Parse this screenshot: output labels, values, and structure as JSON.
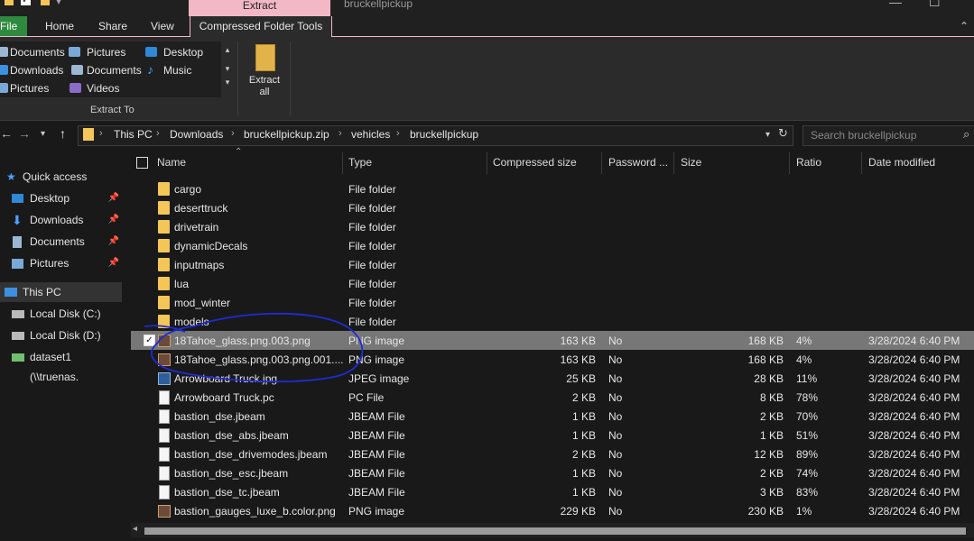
{
  "window": {
    "title": "bruckellpickup",
    "context_tab": "Extract"
  },
  "ribbon_tabs": [
    "File",
    "Home",
    "Share",
    "View",
    "Compressed Folder Tools"
  ],
  "ribbon": {
    "gallery": [
      [
        "Documents",
        "Pictures",
        "Desktop"
      ],
      [
        "Downloads",
        "Documents",
        "Music"
      ],
      [
        "Pictures",
        "Videos",
        ""
      ]
    ],
    "group_label": "Extract To",
    "extract_all_line1": "Extract",
    "extract_all_line2": "all"
  },
  "address": {
    "crumbs": [
      "This PC",
      "Downloads",
      "bruckellpickup.zip",
      "vehicles",
      "bruckellpickup"
    ],
    "search_placeholder": "Search bruckellpickup"
  },
  "nav": {
    "quick_access": "Quick access",
    "items": [
      "Desktop",
      "Downloads",
      "Documents",
      "Pictures"
    ],
    "this_pc": "This PC",
    "drives": [
      "Local Disk (C:)",
      "Local Disk (D:)",
      "dataset1 (\\\\truenas."
    ]
  },
  "columns": [
    "Name",
    "Type",
    "Compressed size",
    "Password ...",
    "Size",
    "Ratio",
    "Date modified"
  ],
  "files": [
    {
      "name": "cargo",
      "type": "File folder",
      "csize": "",
      "pw": "",
      "size": "",
      "ratio": "",
      "date": "",
      "icon": "folder"
    },
    {
      "name": "deserttruck",
      "type": "File folder",
      "csize": "",
      "pw": "",
      "size": "",
      "ratio": "",
      "date": "",
      "icon": "folder"
    },
    {
      "name": "drivetrain",
      "type": "File folder",
      "csize": "",
      "pw": "",
      "size": "",
      "ratio": "",
      "date": "",
      "icon": "folder"
    },
    {
      "name": "dynamicDecals",
      "type": "File folder",
      "csize": "",
      "pw": "",
      "size": "",
      "ratio": "",
      "date": "",
      "icon": "folder"
    },
    {
      "name": "inputmaps",
      "type": "File folder",
      "csize": "",
      "pw": "",
      "size": "",
      "ratio": "",
      "date": "",
      "icon": "folder"
    },
    {
      "name": "lua",
      "type": "File folder",
      "csize": "",
      "pw": "",
      "size": "",
      "ratio": "",
      "date": "",
      "icon": "folder"
    },
    {
      "name": "mod_winter",
      "type": "File folder",
      "csize": "",
      "pw": "",
      "size": "",
      "ratio": "",
      "date": "",
      "icon": "folder"
    },
    {
      "name": "models",
      "type": "File folder",
      "csize": "",
      "pw": "",
      "size": "",
      "ratio": "",
      "date": "",
      "icon": "folder"
    },
    {
      "name": "18Tahoe_glass.png.003.png",
      "type": "PNG image",
      "csize": "163 KB",
      "pw": "No",
      "size": "168 KB",
      "ratio": "4%",
      "date": "3/28/2024 6:40 PM",
      "icon": "png",
      "selected": true
    },
    {
      "name": "18Tahoe_glass.png.003.png.001....",
      "type": "PNG image",
      "csize": "163 KB",
      "pw": "No",
      "size": "168 KB",
      "ratio": "4%",
      "date": "3/28/2024 6:40 PM",
      "icon": "png"
    },
    {
      "name": "Arrowboard Truck.jpg",
      "type": "JPEG image",
      "csize": "25 KB",
      "pw": "No",
      "size": "28 KB",
      "ratio": "11%",
      "date": "3/28/2024 6:40 PM",
      "icon": "jpg"
    },
    {
      "name": "Arrowboard Truck.pc",
      "type": "PC File",
      "csize": "2 KB",
      "pw": "No",
      "size": "8 KB",
      "ratio": "78%",
      "date": "3/28/2024 6:40 PM",
      "icon": "doc"
    },
    {
      "name": "bastion_dse.jbeam",
      "type": "JBEAM File",
      "csize": "1 KB",
      "pw": "No",
      "size": "2 KB",
      "ratio": "70%",
      "date": "3/28/2024 6:40 PM",
      "icon": "doc"
    },
    {
      "name": "bastion_dse_abs.jbeam",
      "type": "JBEAM File",
      "csize": "1 KB",
      "pw": "No",
      "size": "1 KB",
      "ratio": "51%",
      "date": "3/28/2024 6:40 PM",
      "icon": "doc"
    },
    {
      "name": "bastion_dse_drivemodes.jbeam",
      "type": "JBEAM File",
      "csize": "2 KB",
      "pw": "No",
      "size": "12 KB",
      "ratio": "89%",
      "date": "3/28/2024 6:40 PM",
      "icon": "doc"
    },
    {
      "name": "bastion_dse_esc.jbeam",
      "type": "JBEAM File",
      "csize": "1 KB",
      "pw": "No",
      "size": "2 KB",
      "ratio": "74%",
      "date": "3/28/2024 6:40 PM",
      "icon": "doc"
    },
    {
      "name": "bastion_dse_tc.jbeam",
      "type": "JBEAM File",
      "csize": "1 KB",
      "pw": "No",
      "size": "3 KB",
      "ratio": "83%",
      "date": "3/28/2024 6:40 PM",
      "icon": "doc"
    },
    {
      "name": "bastion_gauges_luxe_b.color.png",
      "type": "PNG image",
      "csize": "229 KB",
      "pw": "No",
      "size": "230 KB",
      "ratio": "1%",
      "date": "3/28/2024 6:40 PM",
      "icon": "png"
    }
  ],
  "colors": {
    "accent": "#f2b8c6",
    "file_tab": "#2d8a3e",
    "folder": "#f3c657",
    "selected_row": "#777777",
    "annotation": "#1f2bd6"
  }
}
